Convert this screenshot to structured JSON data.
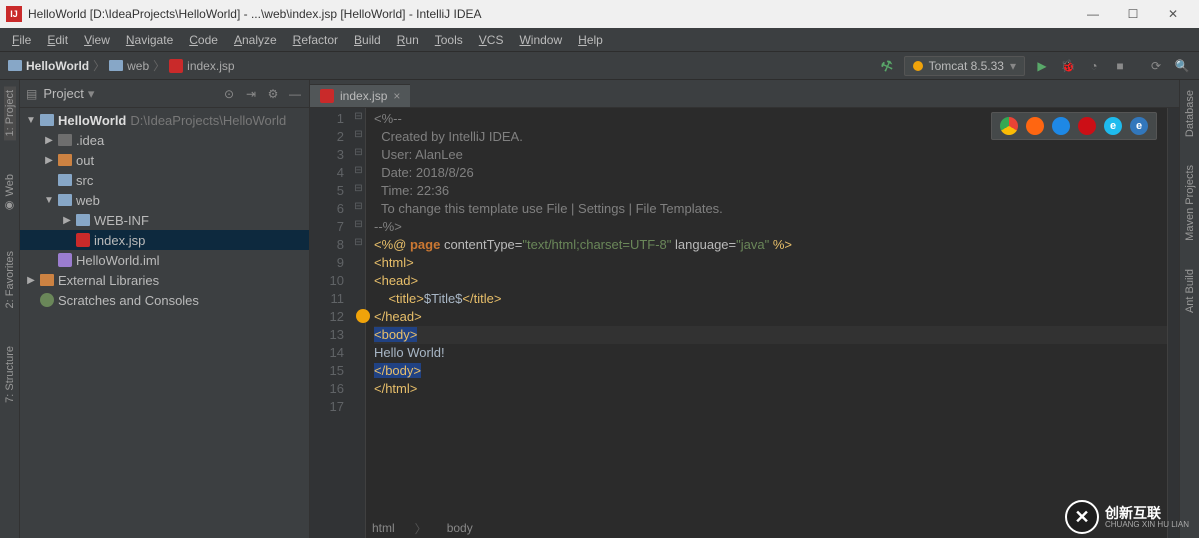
{
  "title": "HelloWorld [D:\\IdeaProjects\\HelloWorld] - ...\\web\\index.jsp [HelloWorld] - IntelliJ IDEA",
  "menus": [
    "File",
    "Edit",
    "View",
    "Navigate",
    "Code",
    "Analyze",
    "Refactor",
    "Build",
    "Run",
    "Tools",
    "VCS",
    "Window",
    "Help"
  ],
  "breadcrumb": [
    {
      "icon": "folder",
      "text": "HelloWorld"
    },
    {
      "icon": "folder",
      "text": "web"
    },
    {
      "icon": "jsp",
      "text": "index.jsp"
    }
  ],
  "run_config": "Tomcat 8.5.33",
  "project_panel": {
    "title": "Project"
  },
  "tree": [
    {
      "indent": 0,
      "arrow": "▼",
      "icon": "folder-blue",
      "label": "HelloWorld",
      "suffix": "D:\\IdeaProjects\\HelloWorld",
      "bold": true
    },
    {
      "indent": 1,
      "arrow": "▶",
      "icon": "folder-gray",
      "label": ".idea"
    },
    {
      "indent": 1,
      "arrow": "▶",
      "icon": "folder-orange",
      "label": "out"
    },
    {
      "indent": 1,
      "arrow": "",
      "icon": "folder-blue",
      "label": "src"
    },
    {
      "indent": 1,
      "arrow": "▼",
      "icon": "folder-blue",
      "label": "web"
    },
    {
      "indent": 2,
      "arrow": "▶",
      "icon": "folder-blue",
      "label": "WEB-INF"
    },
    {
      "indent": 2,
      "arrow": "",
      "icon": "jsp",
      "label": "index.jsp",
      "selected": true
    },
    {
      "indent": 1,
      "arrow": "",
      "icon": "iml",
      "label": "HelloWorld.iml"
    },
    {
      "indent": 0,
      "arrow": "▶",
      "icon": "lib",
      "label": "External Libraries"
    },
    {
      "indent": 0,
      "arrow": "",
      "icon": "scratch",
      "label": "Scratches and Consoles"
    }
  ],
  "tab": {
    "label": "index.jsp"
  },
  "code": {
    "lines": [
      {
        "n": 1,
        "fold": "⊟",
        "html": "<span class='comment'>&lt;%--</span>"
      },
      {
        "n": 2,
        "fold": "",
        "html": "<span class='comment'>  Created by IntelliJ IDEA.</span>"
      },
      {
        "n": 3,
        "fold": "",
        "html": "<span class='comment'>  User: AlanLee</span>"
      },
      {
        "n": 4,
        "fold": "",
        "html": "<span class='comment'>  Date: 2018/8/26</span>"
      },
      {
        "n": 5,
        "fold": "",
        "html": "<span class='comment'>  Time: 22:36</span>"
      },
      {
        "n": 6,
        "fold": "",
        "html": "<span class='comment'>  To change this template use File | Settings | File Templates.</span>"
      },
      {
        "n": 7,
        "fold": "⊟",
        "html": "<span class='comment'>--%&gt;</span>"
      },
      {
        "n": 8,
        "fold": "",
        "html": "<span class='tag'>&lt;%@</span> <span class='kw'>page</span> <span class='attr'>contentType=</span><span class='str'>\"text/html;charset=UTF-8\"</span> <span class='attr'>language=</span><span class='str'>\"java\"</span> <span class='tag'>%&gt;</span>"
      },
      {
        "n": 9,
        "fold": "⊟",
        "html": "<span class='tag'>&lt;html&gt;</span>"
      },
      {
        "n": 10,
        "fold": "⊟",
        "html": "<span class='tag'>&lt;head&gt;</span>"
      },
      {
        "n": 11,
        "fold": "",
        "html": "    <span class='tag'>&lt;title&gt;</span><span class='txt'>$Title$</span><span class='tag'>&lt;/title&gt;</span>"
      },
      {
        "n": 12,
        "fold": "⊟",
        "html": "<span class='tag'>&lt;/head&gt;</span>",
        "bulb": true
      },
      {
        "n": 13,
        "fold": "⊟",
        "html": "<span class='caret-box'><span class='tag'>&lt;body&gt;</span></span>",
        "hl": true
      },
      {
        "n": 14,
        "fold": "",
        "html": "<span class='txt'>Hello World!</span>"
      },
      {
        "n": 15,
        "fold": "⊟",
        "html": "<span class='caret-box'><span class='tag'>&lt;/body&gt;</span></span>"
      },
      {
        "n": 16,
        "fold": "⊟",
        "html": "<span class='tag'>&lt;/html&gt;</span>"
      },
      {
        "n": 17,
        "fold": "",
        "html": ""
      }
    ]
  },
  "browsers": [
    {
      "name": "chrome",
      "bg": "#fff",
      "label": "",
      "style": "background: conic-gradient(#ea4335 0 120deg,#fbbc05 120deg 240deg,#34a853 240deg 360deg);"
    },
    {
      "name": "firefox",
      "bg": "#ff6611"
    },
    {
      "name": "safari",
      "bg": "#1e88e5"
    },
    {
      "name": "opera",
      "bg": "#cc0f16"
    },
    {
      "name": "ie",
      "bg": "#1ebbee",
      "label": "e"
    },
    {
      "name": "edge",
      "bg": "#3277bc",
      "label": "e"
    }
  ],
  "left_tools": [
    {
      "label": "1: Project",
      "selected": true
    },
    {
      "label": "◉ Web"
    },
    {
      "label": "2: Favorites"
    },
    {
      "label": "7: Structure"
    }
  ],
  "right_tools": [
    {
      "label": "Database",
      "icon": "▦"
    },
    {
      "label": "Maven Projects",
      "icon": "m"
    },
    {
      "label": "Ant Build",
      "icon": "🐜"
    }
  ],
  "status_path": [
    "html",
    "body"
  ],
  "watermark": {
    "main": "创新互联",
    "sub": "CHUANG XIN HU LIAN"
  }
}
